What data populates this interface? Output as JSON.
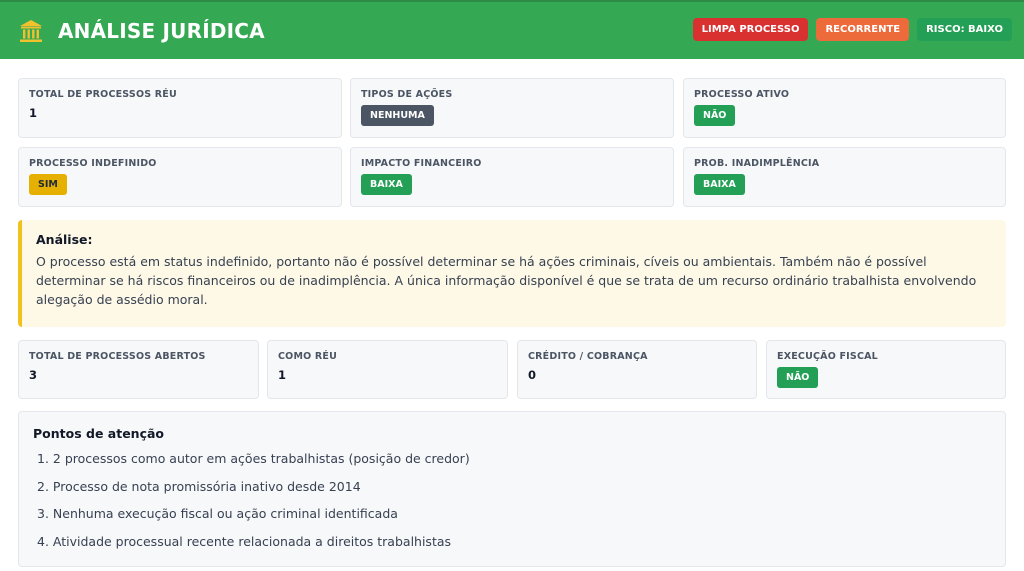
{
  "header": {
    "title": "ANÁLISE JURÍDICA",
    "logo_icon": "courthouse-icon",
    "badges": [
      {
        "label": "LIMPA PROCESSO",
        "color": "#d93030"
      },
      {
        "label": "RECORRENTE",
        "color": "#ed6a3a"
      },
      {
        "label": "RISCO: BAIXO",
        "color": "#23a055"
      }
    ]
  },
  "summary": {
    "total_reu": {
      "label": "TOTAL DE PROCESSOS RÉU",
      "value": "1"
    },
    "tipos_acoes": {
      "label": "TIPOS DE AÇÕES",
      "value": "NENHUMA"
    },
    "processo_ativo": {
      "label": "PROCESSO ATIVO",
      "value": "NÃO"
    },
    "processo_indefinido": {
      "label": "PROCESSO INDEFINIDO",
      "value": "SIM"
    },
    "impacto_financeiro": {
      "label": "IMPACTO FINANCEIRO",
      "value": "BAIXA"
    },
    "prob_inadimplencia": {
      "label": "PROB. INADIMPLÊNCIA",
      "value": "BAIXA"
    }
  },
  "analysis": {
    "title": "Análise:",
    "text": "O processo está em status indefinido, portanto não é possível determinar se há ações criminais, cíveis ou ambientais. Também não é possível determinar se há riscos financeiros ou de inadimplência. A única informação disponível é que se trata de um recurso ordinário trabalhista envolvendo alegação de assédio moral."
  },
  "stats": {
    "abertos": {
      "label": "TOTAL DE PROCESSOS ABERTOS",
      "value": "3"
    },
    "como_reu": {
      "label": "COMO RÉU",
      "value": "1"
    },
    "credito": {
      "label": "CRÉDITO / COBRANÇA",
      "value": "0"
    },
    "execucao": {
      "label": "EXECUÇÃO FISCAL",
      "value": "NÃO"
    }
  },
  "points": {
    "title": "Pontos de atenção",
    "items": [
      "1. 2 processos como autor em ações trabalhistas (posição de credor)",
      "2. Processo de nota promissória inativo desde 2014",
      "3. Nenhuma execução fiscal ou ação criminal identificada",
      "4. Atividade processual recente relacionada a direitos trabalhistas"
    ]
  }
}
